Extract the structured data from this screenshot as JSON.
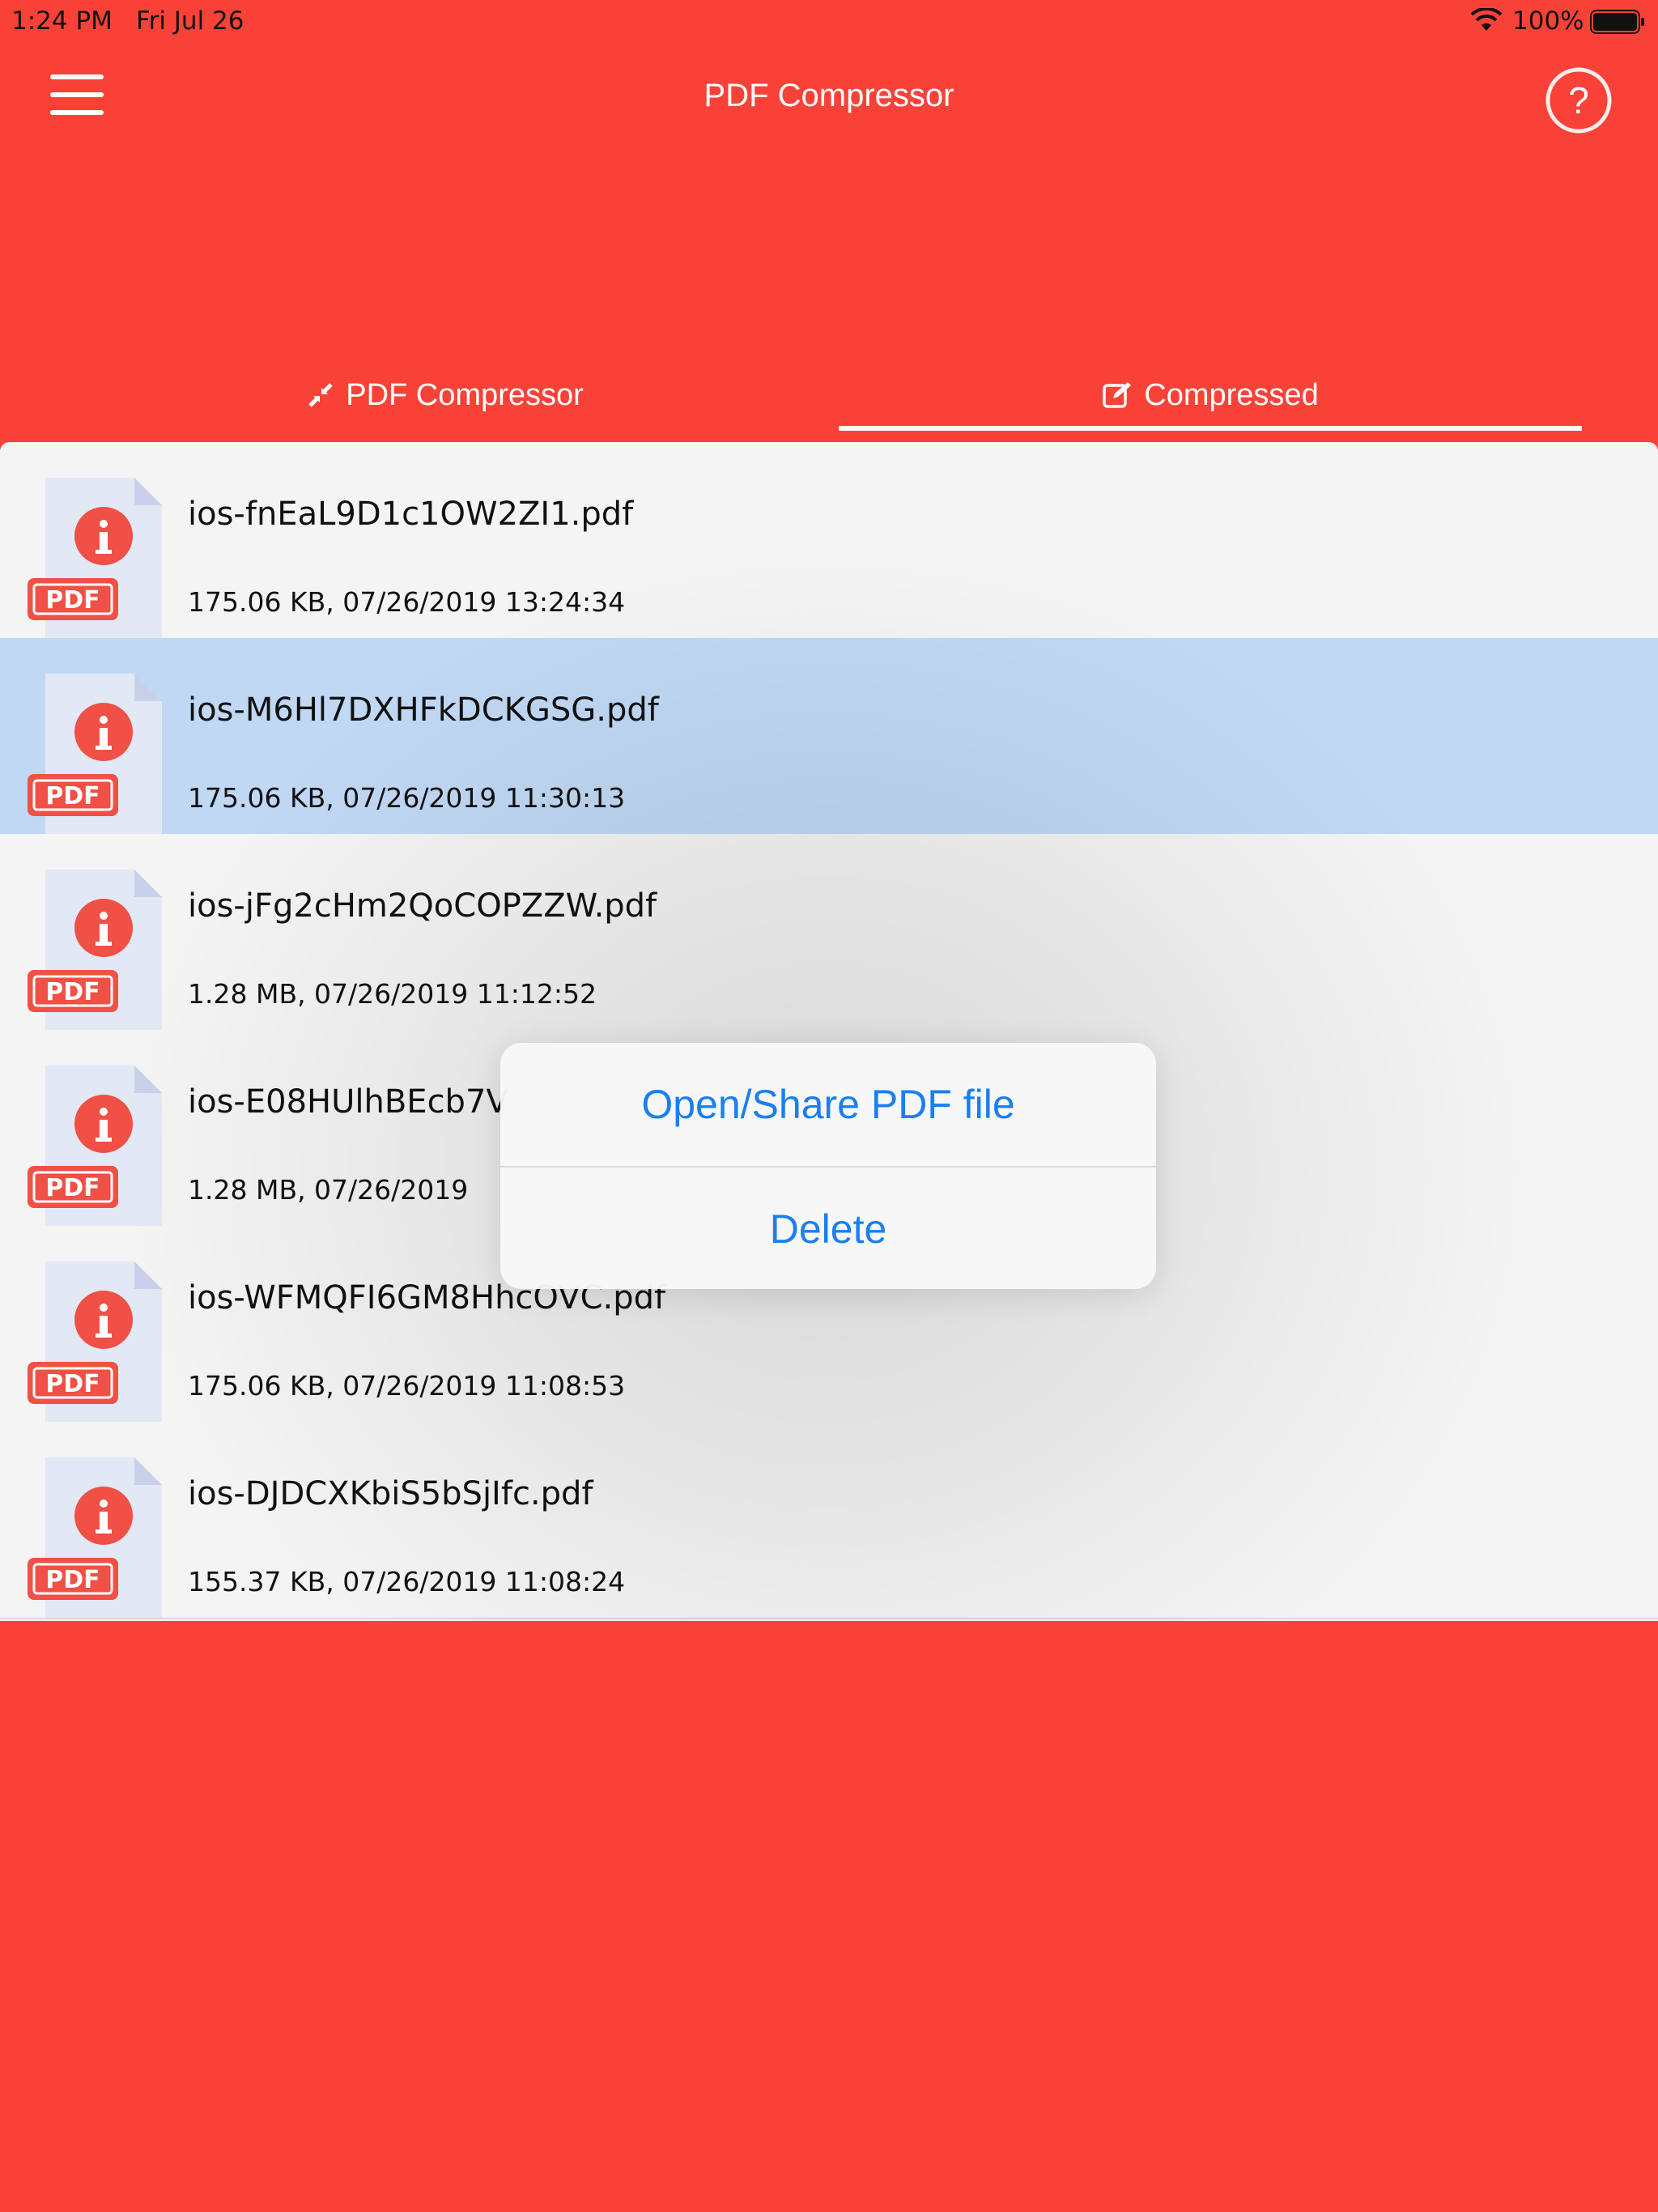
{
  "status_bar": {
    "time": "1:24 PM",
    "date": "Fri Jul 26",
    "battery": "100%"
  },
  "header": {
    "title": "PDF Compressor"
  },
  "tabs": [
    {
      "label": "PDF Compressor",
      "icon": "compress-arrows-icon",
      "active": false
    },
    {
      "label": "Compressed",
      "icon": "edit-icon",
      "active": true
    }
  ],
  "files": [
    {
      "name": "ios-fnEaL9D1c1OW2ZI1.pdf",
      "meta": "175.06 KB, 07/26/2019 13:24:34",
      "selected": false
    },
    {
      "name": "ios-M6Hl7DXHFkDCKGSG.pdf",
      "meta": "175.06 KB, 07/26/2019 11:30:13",
      "selected": true
    },
    {
      "name": "ios-jFg2cHm2QoCOPZZW.pdf",
      "meta": "1.28 MB, 07/26/2019 11:12:52",
      "selected": false
    },
    {
      "name": "ios-E08HUlhBEcb7V",
      "meta": "1.28 MB, 07/26/2019",
      "selected": false
    },
    {
      "name": "ios-WFMQFI6GM8HhcOVC.pdf",
      "meta": "175.06 KB, 07/26/2019 11:08:53",
      "selected": false
    },
    {
      "name": "ios-DJDCXKbiS5bSjIfc.pdf",
      "meta": "155.37 KB, 07/26/2019 11:08:24",
      "selected": false
    }
  ],
  "file_icon": {
    "badge": "PDF",
    "info_glyph": "i"
  },
  "action_sheet": {
    "open_label": "Open/Share PDF file",
    "delete_label": "Delete"
  },
  "colors": {
    "brand_red": "#f84237",
    "action_blue": "#1a7ff0",
    "selected_row": "#c0d8f4"
  }
}
